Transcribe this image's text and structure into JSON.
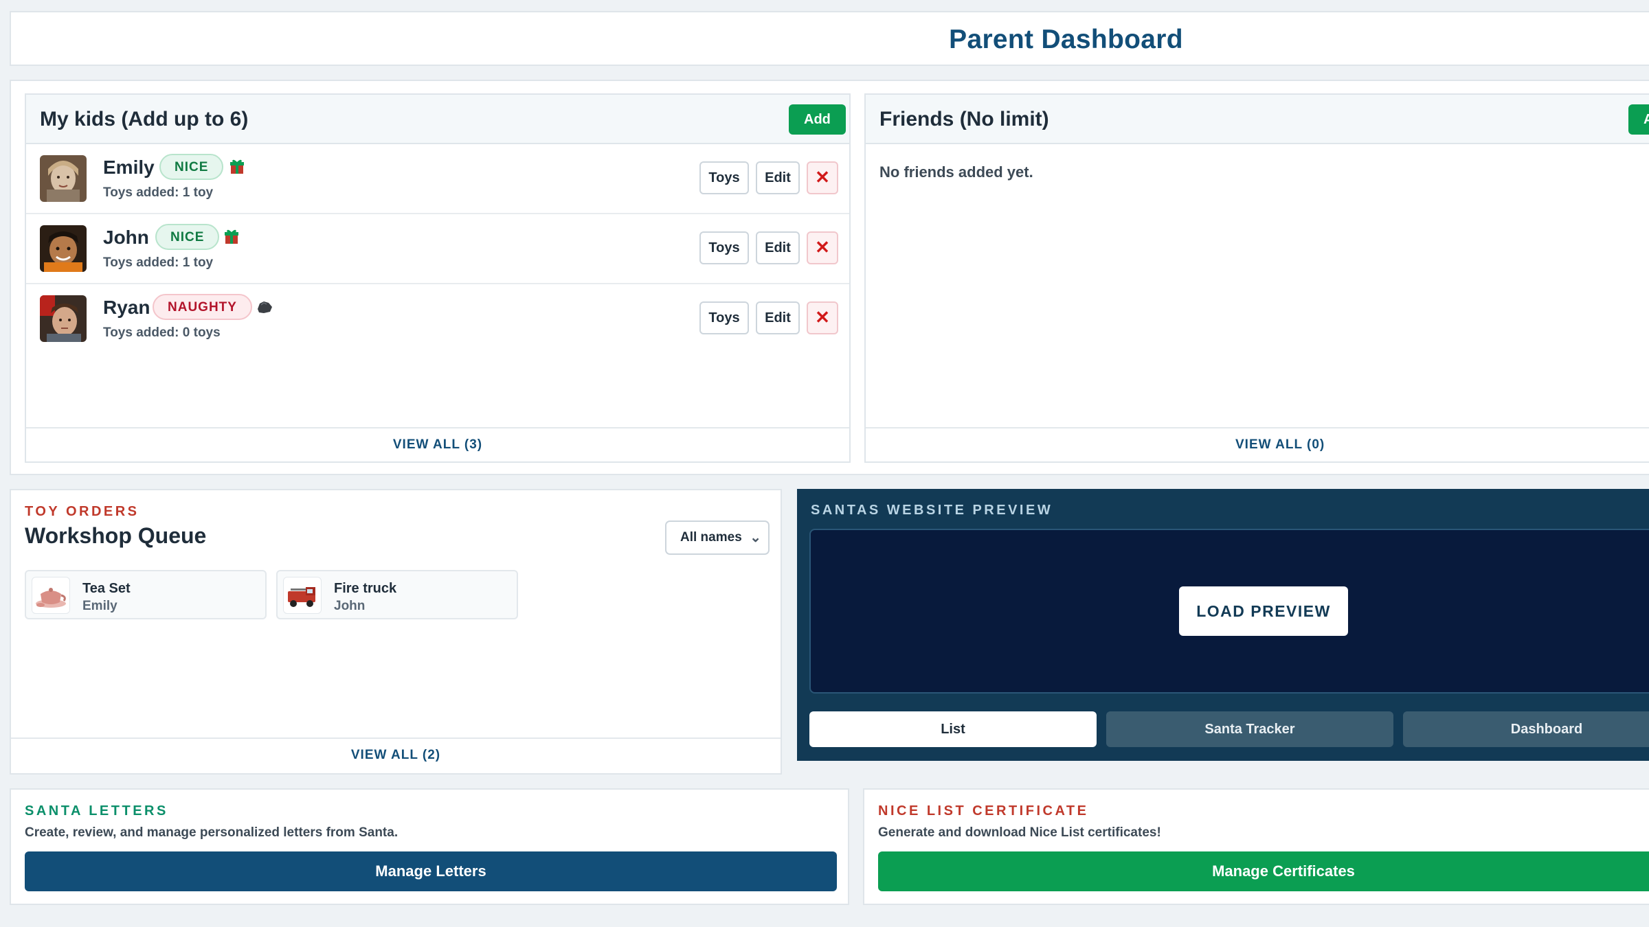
{
  "header": {
    "title": "Parent Dashboard"
  },
  "kids_card": {
    "title": "My kids (Add up to 6)",
    "add_label": "Add",
    "footer": "VIEW ALL (3)",
    "kids": [
      {
        "name": "Emily",
        "status": "NICE",
        "status_icon": "gift-icon",
        "toys_added": "Toys added: 1 toy",
        "toys_label": "Toys",
        "edit_label": "Edit",
        "delete_glyph": "✕"
      },
      {
        "name": "John",
        "status": "NICE",
        "status_icon": "gift-icon",
        "toys_added": "Toys added: 1 toy",
        "toys_label": "Toys",
        "edit_label": "Edit",
        "delete_glyph": "✕"
      },
      {
        "name": "Ryan",
        "status": "NAUGHTY",
        "status_icon": "coal-icon",
        "toys_added": "Toys added: 0 toys",
        "toys_label": "Toys",
        "edit_label": "Edit",
        "delete_glyph": "✕"
      }
    ]
  },
  "friends_card": {
    "title": "Friends (No limit)",
    "add_label": "A",
    "empty_text": "No friends added yet.",
    "footer": "VIEW ALL (0)"
  },
  "toy_orders": {
    "eyebrow": "TOY ORDERS",
    "title": "Workshop Queue",
    "filter_value": "All names",
    "items": [
      {
        "toy": "Tea Set",
        "kid": "Emily",
        "icon": "tea-set-icon"
      },
      {
        "toy": "Fire truck",
        "kid": "John",
        "icon": "fire-truck-icon"
      }
    ],
    "footer": "VIEW ALL (2)"
  },
  "preview": {
    "eyebrow": "SANTAS WEBSITE PREVIEW",
    "load_label": "LOAD PREVIEW",
    "tabs": [
      {
        "label": "List",
        "active": true
      },
      {
        "label": "Santa Tracker",
        "active": false
      },
      {
        "label": "Dashboard",
        "active": false
      }
    ]
  },
  "letters": {
    "eyebrow": "SANTA LETTERS",
    "description": "Create, review, and manage personalized letters from Santa.",
    "button": "Manage Letters"
  },
  "certificate": {
    "eyebrow": "NICE LIST CERTIFICATE",
    "description": "Generate and download Nice List certificates!",
    "button": "Manage Certificates"
  },
  "colors": {
    "brand_blue": "#124e78",
    "green": "#0b9e52",
    "red": "#c0392b",
    "preview_bg": "#123a55"
  }
}
